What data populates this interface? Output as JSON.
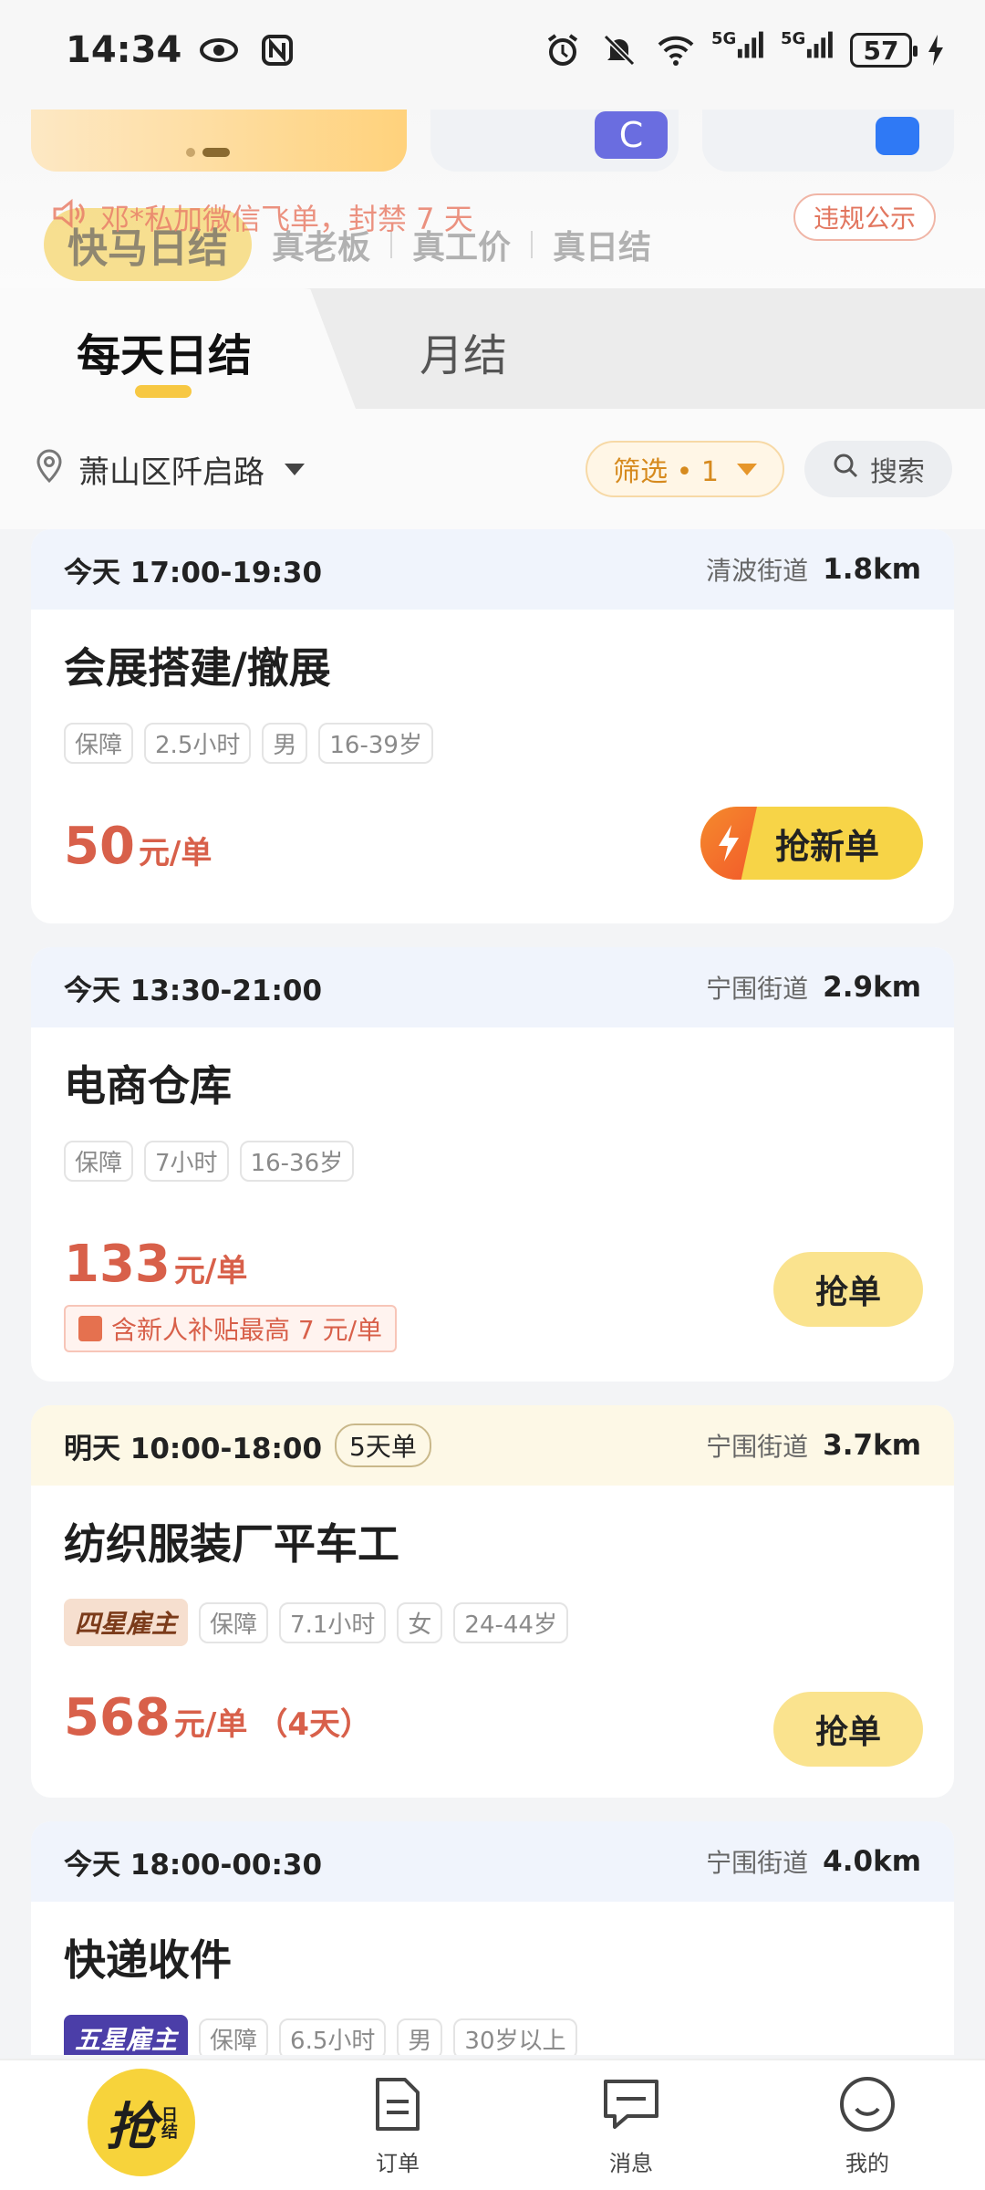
{
  "status_bar": {
    "time": "14:34",
    "battery": "57",
    "signal_1": "5G",
    "signal_2": "5G"
  },
  "banner": {
    "notice_text": "邓*私加微信飞单，封禁 7 天",
    "violation_button": "违规公示",
    "brand_name": "快马日结",
    "brand_tags": [
      "真老板",
      "真工价",
      "真日结"
    ]
  },
  "tabs": {
    "daily": "每天日结",
    "monthly": "月结"
  },
  "filter": {
    "location": "萧山区阡启路",
    "filter_label": "筛选 • 1",
    "search_label": "搜索"
  },
  "jobs": [
    {
      "time": "今天 17:00-19:30",
      "street": "清波街道",
      "distance": "1.8km",
      "title": "会展搭建/撤展",
      "tags": [
        "保障",
        "2.5小时",
        "男",
        "16-39岁"
      ],
      "price": "50",
      "unit": "元/单",
      "action": "抢新单"
    },
    {
      "time": "今天 13:30-21:00",
      "street": "宁围街道",
      "distance": "2.9km",
      "title": "电商仓库",
      "tags": [
        "保障",
        "7小时",
        "16-36岁"
      ],
      "price": "133",
      "unit": "元/单",
      "subsidy": "含新人补贴最高 7 元/单",
      "action": "抢单"
    },
    {
      "time": "明天 10:00-18:00",
      "days_badge": "5天单",
      "street": "宁围街道",
      "distance": "3.7km",
      "title": "纺织服装厂平车工",
      "rank": "四星雇主",
      "tags": [
        "保障",
        "7.1小时",
        "女",
        "24-44岁"
      ],
      "price": "568",
      "unit": "元/单",
      "extra": "（4天）",
      "action": "抢单"
    },
    {
      "time": "今天 18:00-00:30",
      "street": "宁围街道",
      "distance": "4.0km",
      "title": "快递收件",
      "rank": "五星雇主",
      "tags": [
        "保障",
        "6.5小时",
        "男",
        "30岁以上"
      ]
    }
  ],
  "bottom_nav": {
    "grab_big": "抢",
    "grab_small": "日结",
    "orders": "订单",
    "messages": "消息",
    "mine": "我的"
  },
  "colors": {
    "accent_yellow": "#f7d33b",
    "price_red": "#d8604a",
    "filter_orange": "#d68a1e"
  }
}
